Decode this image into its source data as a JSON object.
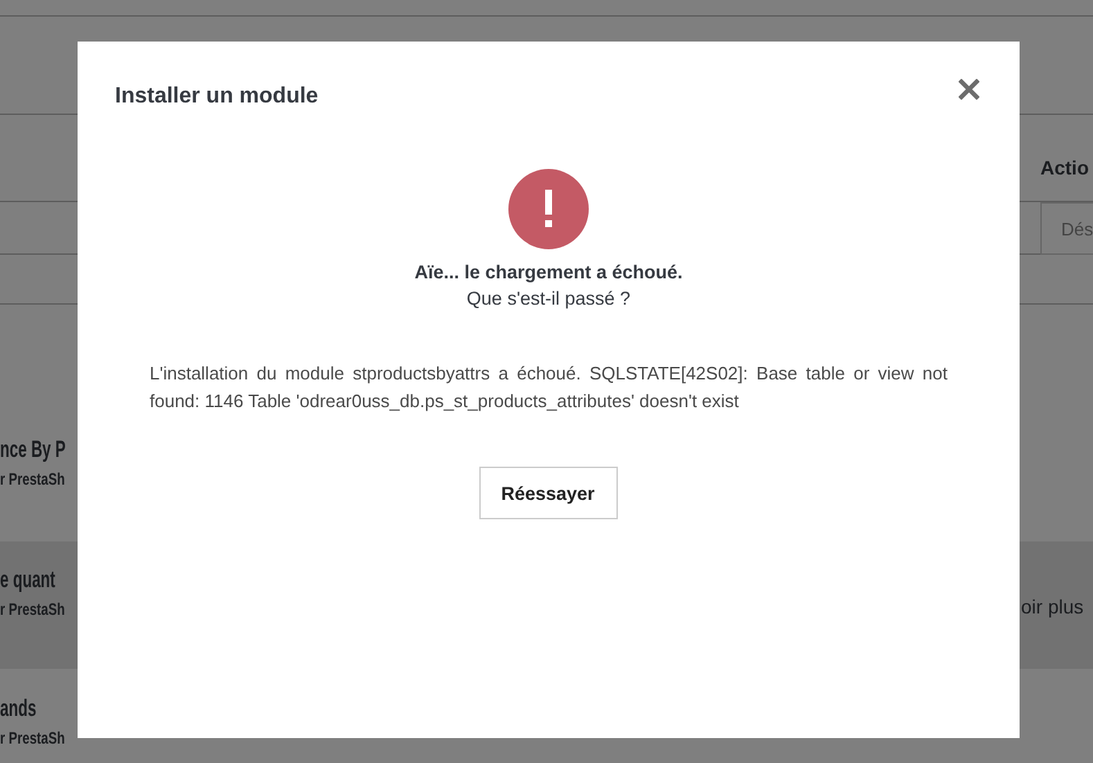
{
  "background": {
    "column_header": "Actio",
    "field_value": "Dés",
    "modules": [
      {
        "name": "nce By P",
        "author": "r PrestaSh",
        "highlighted": false
      },
      {
        "name": "e quant",
        "author": "r PrestaSh",
        "highlighted": true,
        "description": "oir plus"
      },
      {
        "name": "ands",
        "author": "r PrestaSh",
        "highlighted": false
      }
    ]
  },
  "modal": {
    "title": "Installer un module",
    "heading": "Aïe... le chargement a échoué.",
    "subheading": "Que s'est-il passé ?",
    "message": "L'installation du module stproductsbyattrs a échoué. SQLSTATE[42S02]: Base table or view not found: 1146 Table 'odrear0uss_db.ps_st_products_attributes' doesn't exist",
    "button": "Réessayer"
  }
}
